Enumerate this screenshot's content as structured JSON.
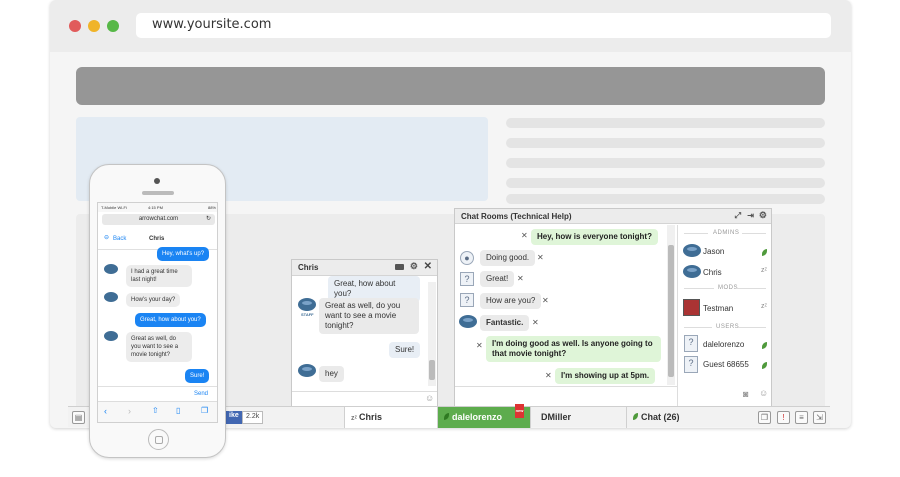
{
  "browser": {
    "url": "www.yoursite.com",
    "colors": {
      "close": "#e15b5b",
      "minimize": "#f0b429",
      "zoom": "#57b847"
    }
  },
  "bottom_bar": {
    "like_count": "2.2k",
    "like_label": "ike",
    "tabs": {
      "chris": "Chris",
      "dalelorenzo": "dalelorenzo",
      "dmiller": "DMiller",
      "chat": "Chat (26)"
    },
    "badge": "new"
  },
  "chris_window": {
    "title": "Chris",
    "messages": [
      "Great, how about you?",
      "Great as well, do you want to see a movie tonight?",
      "Sure!",
      "hey"
    ]
  },
  "chat_rooms": {
    "title": "Chat Rooms  (Technical Help)",
    "messages": [
      "Hey, how is everyone tonight?",
      "Doing good.",
      "Great!",
      "How are you?",
      "Fantastic.",
      "I'm doing good as well. Is anyone going to that movie tonight?",
      "I'm showing up at 5pm."
    ],
    "sections": {
      "admins": "ADMINS",
      "mods": "MODS",
      "users": "USERS"
    },
    "users": {
      "jason": "Jason",
      "chris": "Chris",
      "testman": "Testman",
      "dalelorenzo": "dalelorenzo",
      "guest": "Guest 68655"
    },
    "staff_label": "STAFF"
  },
  "phone": {
    "status_left": "T-Mobile Wi-Fi",
    "status_time": "4:15 PM",
    "status_right": "88%",
    "url": "arrowchat.com",
    "back": "Back",
    "contact": "Chris",
    "messages": [
      "Hey, what's up?",
      "I had a great time last night!",
      "How's your day?",
      "Great, how about you?",
      "Great as well, do you want to see a movie tonight?",
      "Sure!"
    ],
    "send": "Send"
  }
}
